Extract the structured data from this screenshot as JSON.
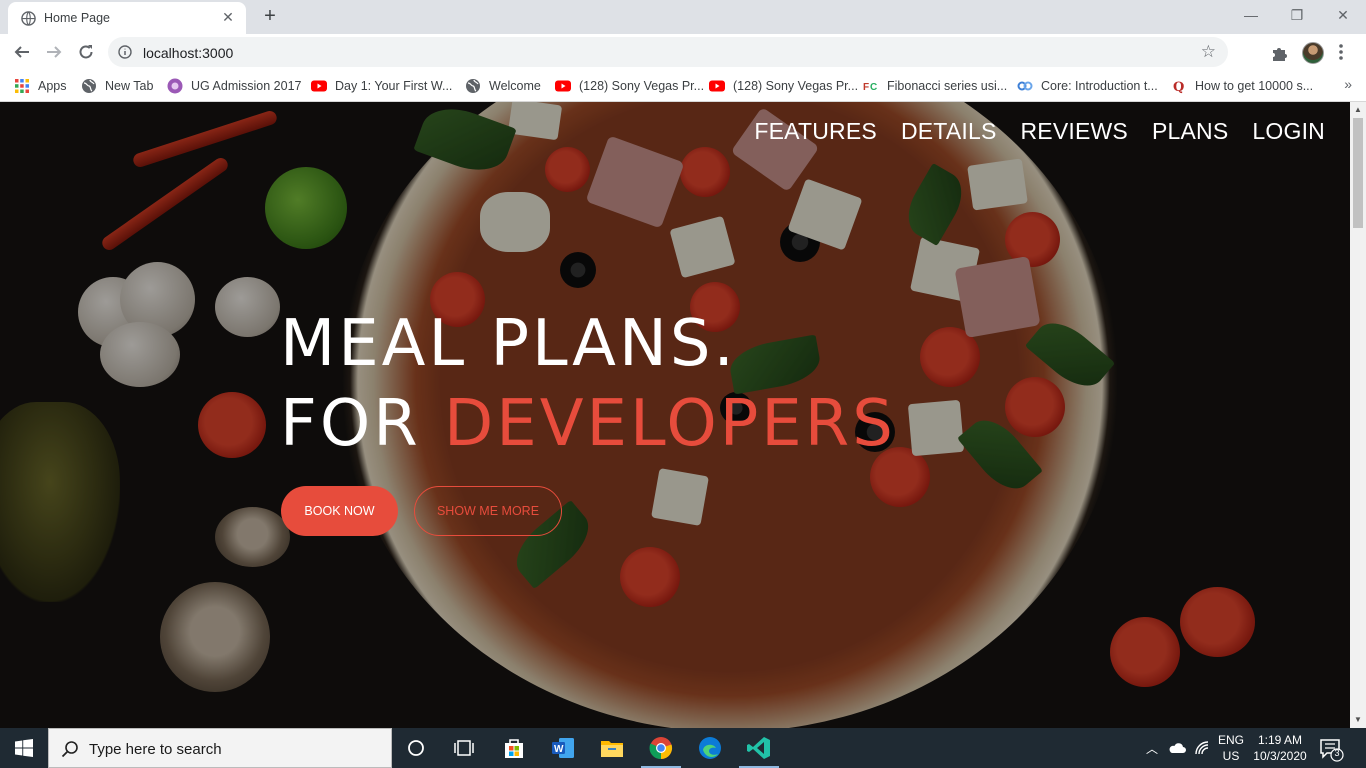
{
  "browser": {
    "tab_title": "Home Page",
    "url": "localhost:3000",
    "bookmarks": [
      {
        "label": "Apps",
        "icon": "apps-grid-icon"
      },
      {
        "label": "New Tab",
        "icon": "globe-icon"
      },
      {
        "label": "UG Admission 2017",
        "icon": "site-icon"
      },
      {
        "label": "Day 1: Your First W...",
        "icon": "youtube-icon"
      },
      {
        "label": "Welcome",
        "icon": "globe-icon"
      },
      {
        "label": "(128) Sony Vegas Pr...",
        "icon": "youtube-icon"
      },
      {
        "label": "(128) Sony Vegas Pr...",
        "icon": "youtube-icon"
      },
      {
        "label": "Fibonacci series usi...",
        "icon": "fc-icon"
      },
      {
        "label": "Core: Introduction t...",
        "icon": "link-icon"
      },
      {
        "label": "How to get 10000 s...",
        "icon": "quora-icon"
      }
    ],
    "bookmarks_more": "»"
  },
  "page": {
    "nav": [
      "FEATURES",
      "DETAILS",
      "REVIEWS",
      "PLANS",
      "LOGIN"
    ],
    "hero": {
      "line1": "MEAL PLANS.",
      "line2_prefix": "FOR ",
      "line2_accent": "DEVELOPERS"
    },
    "primary_button": "BOOK NOW",
    "secondary_button": "SHOW ME MORE",
    "accent_color": "#e74c3c"
  },
  "taskbar": {
    "search_placeholder": "Type here to search",
    "lang_top": "ENG",
    "lang_bottom": "US",
    "time": "1:19 AM",
    "date": "10/3/2020",
    "notifications": "3",
    "apps": [
      "task-view",
      "store",
      "word",
      "file-explorer",
      "chrome",
      "edge",
      "vs-code"
    ]
  }
}
